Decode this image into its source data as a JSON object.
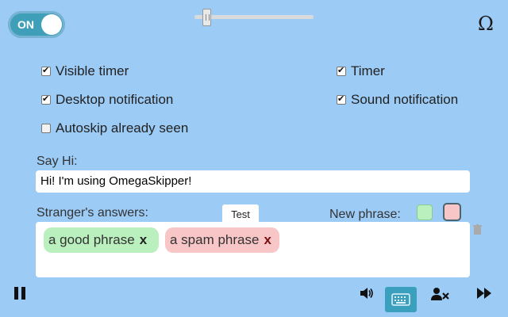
{
  "toggle": {
    "label": "ON",
    "state": true
  },
  "volume_level": 0.08,
  "omega_symbol": "Ω",
  "options": {
    "visible_timer": {
      "label": "Visible timer",
      "checked": true
    },
    "timer": {
      "label": "Timer",
      "checked": true
    },
    "desktop_notification": {
      "label": "Desktop notification",
      "checked": true
    },
    "sound_notification": {
      "label": "Sound notification",
      "checked": true
    },
    "autoskip": {
      "label": "Autoskip already seen",
      "checked": false
    }
  },
  "say_hi": {
    "label": "Say Hi:",
    "value": "Hi! I'm using OmegaSkipper!"
  },
  "answers": {
    "label": "Stranger's answers:",
    "test_label": "Test",
    "new_phrase_label": "New phrase:",
    "phrases": [
      {
        "text": "a good phrase",
        "remove": "x",
        "type": "good"
      },
      {
        "text": "a spam phrase",
        "remove": "x",
        "type": "spam"
      }
    ]
  },
  "colors": {
    "background": "#9ccbf6",
    "good": "#b9f0bd",
    "spam": "#f9c6c8",
    "accent": "#3aa0be"
  },
  "icons": {
    "pause": "pause-icon",
    "volume": "volume-icon",
    "keyboard": "keyboard-icon",
    "block_user": "block-user-icon",
    "skip": "skip-icon",
    "trash": "trash-icon",
    "omega": "omega-icon"
  }
}
